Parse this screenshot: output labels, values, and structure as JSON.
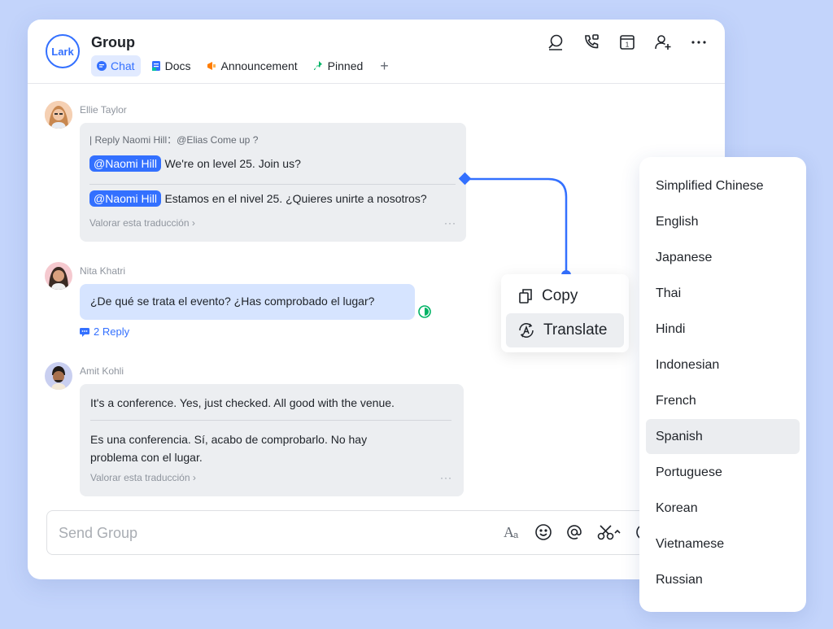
{
  "header": {
    "logo_text": "Lark",
    "title": "Group",
    "tabs": [
      {
        "label": "Chat",
        "icon": "chat-icon",
        "color": "#3370ff"
      },
      {
        "label": "Docs",
        "icon": "docs-icon",
        "color": "#3370ff"
      },
      {
        "label": "Announcement",
        "icon": "megaphone-icon",
        "color": "#ff7d00"
      },
      {
        "label": "Pinned",
        "icon": "pin-icon",
        "color": "#00b365"
      }
    ],
    "add_tab": "+",
    "icons": [
      "search-icon",
      "call-icon",
      "calendar-icon",
      "add-member-icon",
      "more-icon"
    ]
  },
  "messages": [
    {
      "sender": "Ellie Taylor",
      "reply_to": "| Reply Naomi Hill：@Elias Come up ?",
      "mention": "@Naomi Hill",
      "original": "We're on level 25. Join us?",
      "translation_mention": "@Naomi Hill",
      "translation": "Estamos en el nivel 25. ¿Quieres unirte a nosotros?",
      "rate_label": "Valorar esta traducción",
      "more": "···"
    },
    {
      "sender": "Nita Khatri",
      "text": "¿De qué se trata el evento? ¿Has comprobado el lugar?",
      "reply_count": "2 Reply"
    },
    {
      "sender": "Amit Kohli",
      "original": "It's a conference. Yes, just checked. All good with the venue.",
      "translation": "Es una conferencia. Sí, acabo de comprobarlo. No hay problema con el lugar.",
      "rate_label": "Valorar esta traducción",
      "more": "···"
    }
  ],
  "composer": {
    "placeholder": "Send Group",
    "icons": [
      "text-format-icon",
      "emoji-icon",
      "mention-icon",
      "scissors-icon",
      "plus-circle-icon"
    ]
  },
  "context_menu": {
    "items": [
      {
        "label": "Copy",
        "icon": "copy-icon"
      },
      {
        "label": "Translate",
        "icon": "translate-icon"
      }
    ]
  },
  "languages": {
    "items": [
      "Simplified Chinese",
      "English",
      "Japanese",
      "Thai",
      "Hindi",
      "Indonesian",
      "French",
      "Spanish",
      "Portuguese",
      "Korean",
      "Vietnamese",
      "Russian"
    ],
    "selected": "Spanish"
  },
  "colors": {
    "accent": "#3370ff",
    "background": "#c3d4fb",
    "status": "#00b365"
  }
}
